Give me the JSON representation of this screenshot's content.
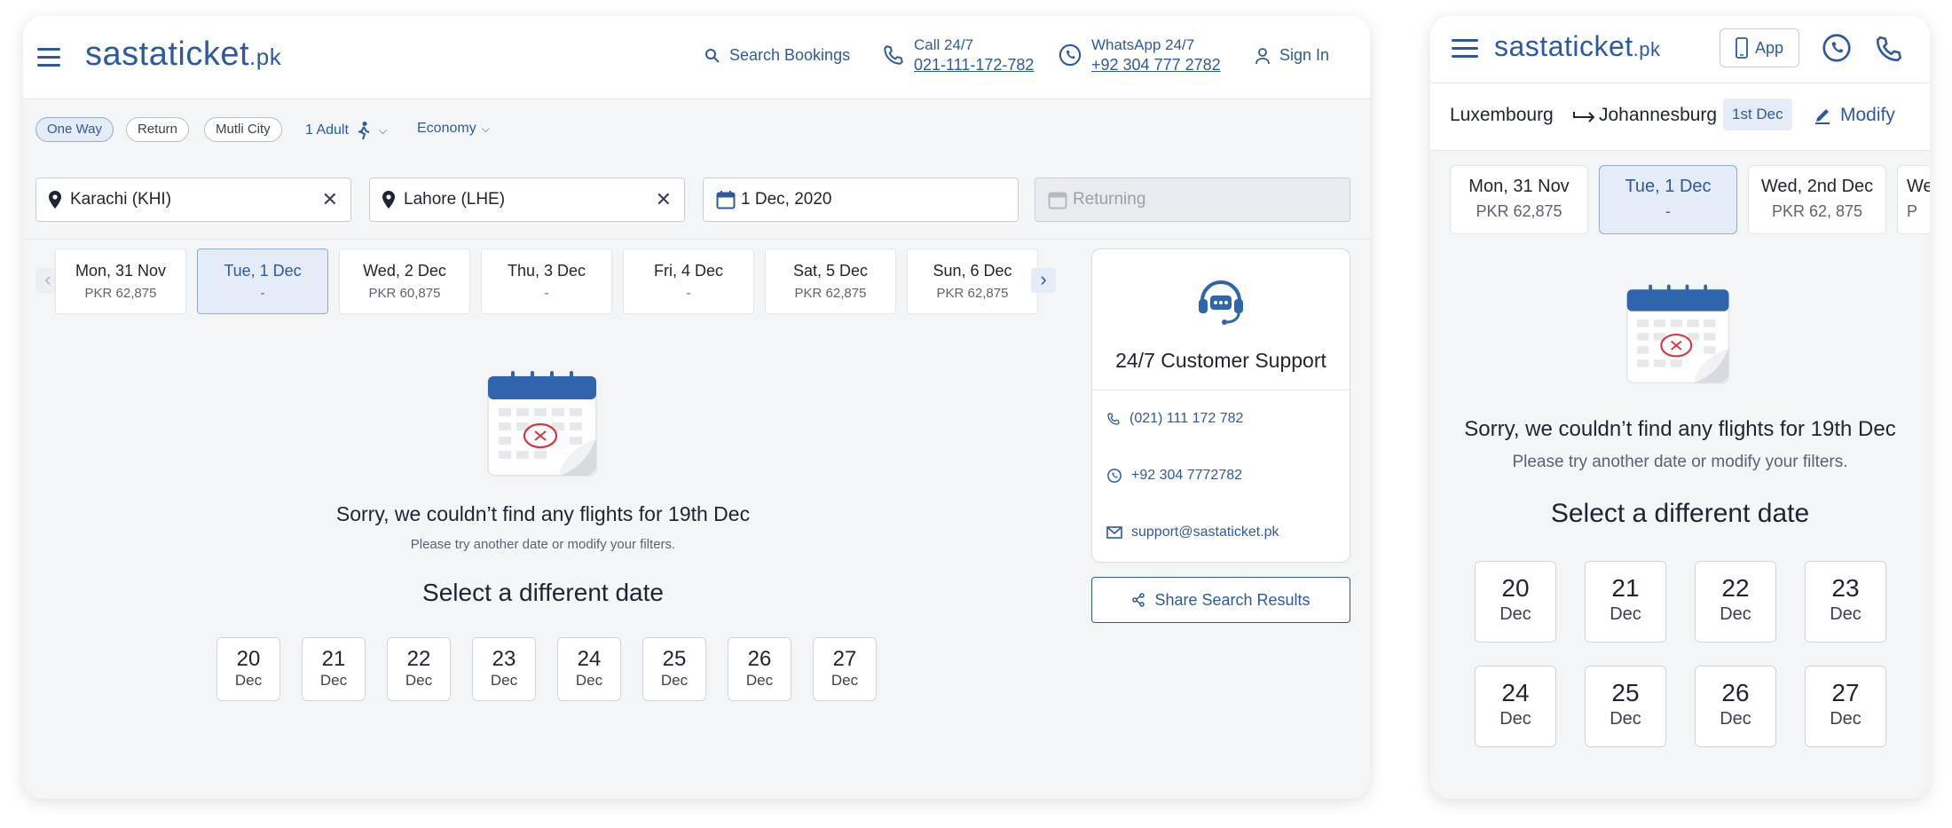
{
  "desktop": {
    "logo": "sastaticket",
    "logo_suffix": ".pk",
    "nav": {
      "search_bookings": "Search Bookings",
      "call_label": "Call 24/7",
      "call_number": "021-111-172-782",
      "whatsapp_label": "WhatsApp 24/7",
      "whatsapp_number": "+92 304 777 2782",
      "sign_in": "Sign In"
    },
    "trip_types": [
      "One Way",
      "Return",
      "Mutli City"
    ],
    "passengers": "1 Adult",
    "cabin": "Economy",
    "from": "Karachi (KHI)",
    "to": "Lahore (LHE)",
    "depart": "1 Dec, 2020",
    "return_placeholder": "Returning",
    "dates": [
      {
        "day": "Mon, 31 Nov",
        "price": "PKR 62,875"
      },
      {
        "day": "Tue, 1 Dec",
        "price": "-"
      },
      {
        "day": "Wed, 2 Dec",
        "price": "PKR 60,875"
      },
      {
        "day": "Thu, 3 Dec",
        "price": "-"
      },
      {
        "day": "Fri, 4 Dec",
        "price": "-"
      },
      {
        "day": "Sat, 5 Dec",
        "price": "PKR 62,875"
      },
      {
        "day": "Sun, 6 Dec",
        "price": "PKR 62,875"
      }
    ],
    "empty": {
      "title": "Sorry, we couldn’t find any flights for 19th Dec",
      "subtitle": "Please try another date or modify your filters.",
      "select_title": "Select a different date"
    },
    "alt_dates": [
      {
        "n": "20",
        "m": "Dec"
      },
      {
        "n": "21",
        "m": "Dec"
      },
      {
        "n": "22",
        "m": "Dec"
      },
      {
        "n": "23",
        "m": "Dec"
      },
      {
        "n": "24",
        "m": "Dec"
      },
      {
        "n": "25",
        "m": "Dec"
      },
      {
        "n": "26",
        "m": "Dec"
      },
      {
        "n": "27",
        "m": "Dec"
      }
    ],
    "support": {
      "title": "24/7 Customer Support",
      "phone": "(021) 111 172 782",
      "whatsapp": "+92 304 7772782",
      "email": "support@sastaticket.pk"
    },
    "share": "Share Search Results"
  },
  "mobile": {
    "logo": "sastaticket",
    "logo_suffix": ".pk",
    "app_label": "App",
    "from": "Luxembourg",
    "to": "Johannesburg",
    "date_badge": "1st Dec",
    "modify": "Modify",
    "dates": [
      {
        "day": "Mon, 31 Nov",
        "price": "PKR 62,875"
      },
      {
        "day": "Tue, 1 Dec",
        "price": "-"
      },
      {
        "day": "Wed, 2nd Dec",
        "price": "PKR 62, 875"
      },
      {
        "day": "We",
        "price": "P"
      }
    ],
    "empty": {
      "title": "Sorry, we couldn’t find any flights for 19th Dec",
      "subtitle": "Please try another date or modify your filters.",
      "select_title": "Select a different date"
    },
    "alt_dates": [
      {
        "n": "20",
        "m": "Dec"
      },
      {
        "n": "21",
        "m": "Dec"
      },
      {
        "n": "22",
        "m": "Dec"
      },
      {
        "n": "23",
        "m": "Dec"
      },
      {
        "n": "24",
        "m": "Dec"
      },
      {
        "n": "25",
        "m": "Dec"
      },
      {
        "n": "26",
        "m": "Dec"
      },
      {
        "n": "27",
        "m": "Dec"
      }
    ]
  },
  "colors": {
    "brand": "#2c5aa0",
    "selected_bg": "#e3ecf7",
    "error": "#d9343a"
  }
}
